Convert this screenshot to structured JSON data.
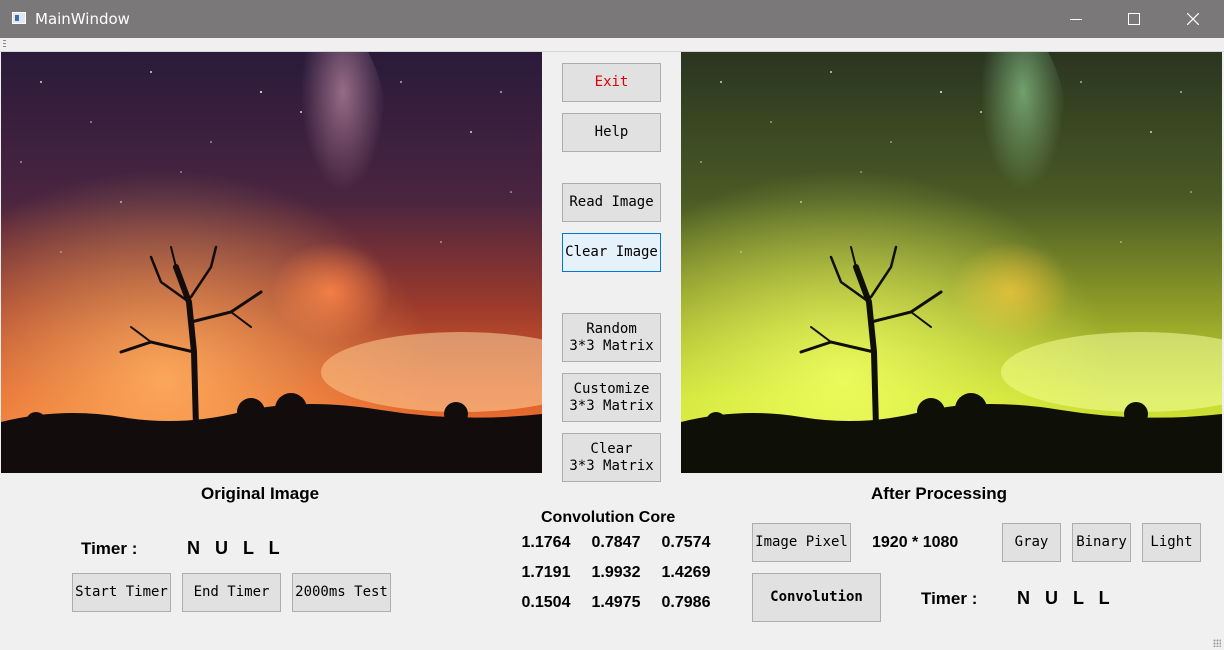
{
  "window": {
    "title": "MainWindow",
    "controls": {
      "minimize": "minimize-icon",
      "maximize": "maximize-icon",
      "close": "close-icon"
    }
  },
  "left_panel": {
    "caption": "Original Image",
    "timer_label": "Timer :",
    "timer_value": "N U L L",
    "buttons": {
      "start": "Start Timer",
      "end": "End Timer",
      "test": "2000ms Test"
    }
  },
  "center_panel": {
    "exit": "Exit",
    "help": "Help",
    "read_image": "Read Image",
    "clear_image": "Clear Image",
    "random_matrix": [
      "Random",
      "3*3 Matrix"
    ],
    "customize_matrix": [
      "Customize",
      "3*3 Matrix"
    ],
    "clear_matrix": [
      "Clear",
      "3*3 Matrix"
    ],
    "convolution_title": "Convolution Core",
    "matrix": [
      [
        "1.1764",
        "0.7847",
        "0.7574"
      ],
      [
        "1.7191",
        "1.9932",
        "1.4269"
      ],
      [
        "0.1504",
        "1.4975",
        "0.7986"
      ]
    ]
  },
  "right_panel": {
    "caption": "After Processing",
    "image_pixel_button": "Image Pixel",
    "image_pixel_value": "1920 * 1080",
    "gray": "Gray",
    "binary": "Binary",
    "light": "Light",
    "convolution": "Convolution",
    "timer_label": "Timer :",
    "timer_value": "N U L L"
  },
  "colors": {
    "titlebar": "#7a7878",
    "exit_text": "#e00000",
    "focus_border": "#0078d7"
  }
}
